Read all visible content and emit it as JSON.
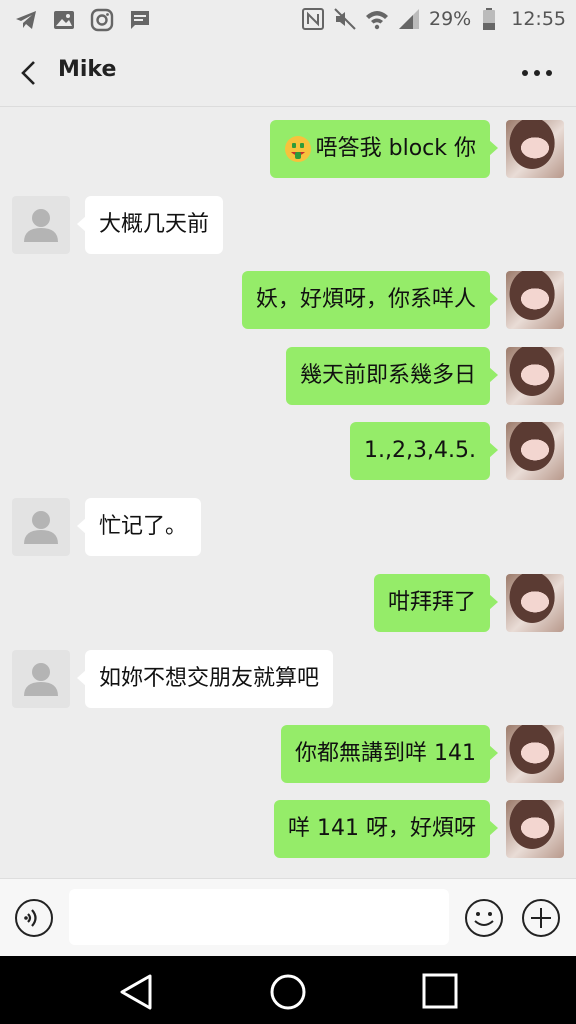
{
  "status_bar": {
    "battery": "29%",
    "time": "12:55",
    "icons_left": [
      "telegram-icon",
      "gallery-icon",
      "instagram-icon",
      "message-icon"
    ],
    "icons_right": [
      "nfc-icon",
      "mute-icon",
      "wifi-icon",
      "signal-icon",
      "battery-icon"
    ]
  },
  "header": {
    "title": "Mike",
    "back_icon": "chevron-left-icon",
    "more_icon": "more-dots-icon"
  },
  "messages": [
    {
      "sender": "me",
      "text": "唔答我 block 你",
      "has_emoji": true,
      "emoji": "money-mouth-face"
    },
    {
      "sender": "other",
      "text": "大概几天前"
    },
    {
      "sender": "me",
      "text": "妖，好煩呀，你系咩人"
    },
    {
      "sender": "me",
      "text": "幾天前即系幾多日"
    },
    {
      "sender": "me",
      "text": "1.,2,3,4.5."
    },
    {
      "sender": "other",
      "text": "忙记了。"
    },
    {
      "sender": "me",
      "text": "咁拜拜了"
    },
    {
      "sender": "other",
      "text": "如妳不想交朋友就算吧"
    },
    {
      "sender": "me",
      "text": "你都無講到咩 141"
    },
    {
      "sender": "me",
      "text": "咩 141 呀，好煩呀"
    }
  ],
  "input_bar": {
    "placeholder": "",
    "voice_icon": "voice-icon",
    "emoji_icon": "smiley-icon",
    "plus_icon": "plus-circle-icon"
  },
  "nav_bar": {
    "icons": [
      "nav-back-icon",
      "nav-home-icon",
      "nav-recent-icon"
    ]
  }
}
